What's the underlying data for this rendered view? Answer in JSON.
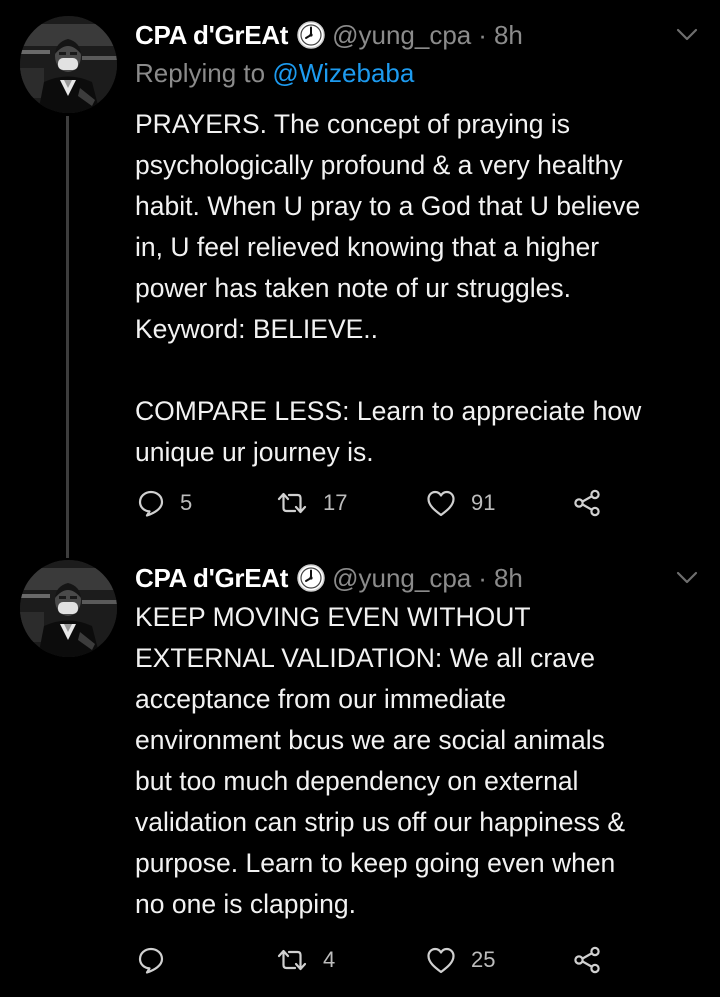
{
  "colors": {
    "background": "#000000",
    "text": "#f2f2f2",
    "muted": "#8b8b8b",
    "mention": "#1d9bf0",
    "thread_line": "#3d3d3d"
  },
  "tweets": [
    {
      "author": {
        "display_name": "CPA d'GrEAt",
        "badge_icon": "clock-badge-icon",
        "handle": "@yung_cpa",
        "separator": "·",
        "time": "8h"
      },
      "reply": {
        "prefix": "Replying to",
        "mention": "@Wizebaba"
      },
      "text_lines": [
        "PRAYERS. The concept of praying is",
        "psychologically profound & a very healthy",
        "habit. When U pray to a God that U believe",
        "in, U feel relieved knowing that a higher",
        "power has taken note of ur struggles.",
        "Keyword: BELIEVE..",
        "",
        "COMPARE LESS: Learn to appreciate how",
        "unique ur journey is."
      ],
      "actions": {
        "reply_count": "5",
        "retweet_count": "17",
        "like_count": "91"
      }
    },
    {
      "author": {
        "display_name": "CPA d'GrEAt",
        "badge_icon": "clock-badge-icon",
        "handle": "@yung_cpa",
        "separator": "·",
        "time": "8h"
      },
      "text_lines": [
        "KEEP MOVING EVEN WITHOUT",
        "EXTERNAL VALIDATION: We all crave",
        "acceptance from our immediate",
        "environment bcus we are social animals",
        "but too much dependency on external",
        "validation can strip us off our happiness &",
        "purpose. Learn to keep going even when",
        "no one is clapping."
      ],
      "actions": {
        "reply_count": "",
        "retweet_count": "4",
        "like_count": "25"
      }
    }
  ]
}
